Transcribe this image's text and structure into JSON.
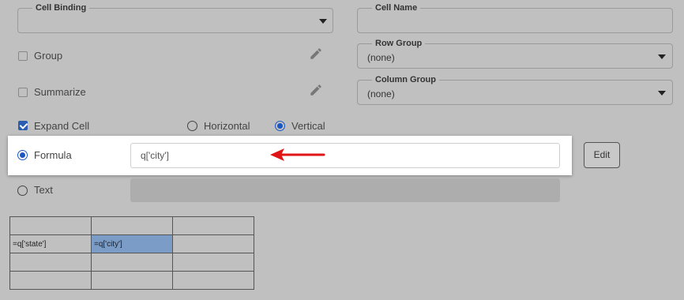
{
  "cell_binding": {
    "legend": "Cell Binding",
    "value": ""
  },
  "cell_name": {
    "legend": "Cell Name",
    "value": ""
  },
  "row_group": {
    "legend": "Row Group",
    "value": "(none)"
  },
  "column_group": {
    "legend": "Column Group",
    "value": "(none)"
  },
  "options": {
    "group": {
      "label": "Group",
      "checked": false
    },
    "summarize": {
      "label": "Summarize",
      "checked": false
    },
    "expand_cell": {
      "label": "Expand Cell",
      "checked": true
    }
  },
  "direction": {
    "horizontal": {
      "label": "Horizontal",
      "selected": false
    },
    "vertical": {
      "label": "Vertical",
      "selected": true
    }
  },
  "content_type": {
    "formula": {
      "label": "Formula",
      "selected": true,
      "value": "q['city']"
    },
    "text": {
      "label": "Text",
      "selected": false,
      "value": ""
    }
  },
  "edit_button": {
    "label": "Edit"
  },
  "grid": {
    "rows": [
      [
        "",
        "",
        ""
      ],
      [
        "=q['state']",
        "=q['city']",
        ""
      ],
      [
        "",
        "",
        ""
      ],
      [
        "",
        "",
        ""
      ]
    ],
    "selected_cell": [
      1,
      1
    ]
  },
  "colors": {
    "background": "#c0c0c0",
    "accent": "#1a57c4",
    "selected_cell": "#7a9cc6",
    "arrow": "#e01414"
  }
}
